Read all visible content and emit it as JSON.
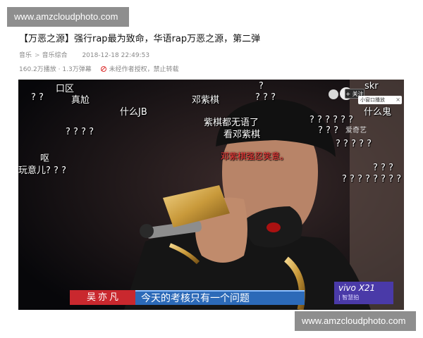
{
  "watermarks": {
    "top": "www.amzcloudphoto.com",
    "bottom": "www.amzcloudphoto.com"
  },
  "article": {
    "title": "【万恶之源】强行rap最为致命，华语rap万恶之源，第二弹",
    "category": "音乐",
    "subcategory": "音乐综合",
    "date": "2018-12-18 22:49:53",
    "plays": "160.2万播放",
    "danmaku_count": "1.3万弹幕",
    "notice": "未经作者授权，禁止转载"
  },
  "video": {
    "follow_label": "+ 关注",
    "mini_window_label": "小窗口播放",
    "close_glyph": "×",
    "channel_tag": "爱奇艺",
    "name_tag": "吴亦凡",
    "subtitle": "今天的考核只有一个问题",
    "sponsor_title": "vivo X21",
    "sponsor_sub": "| 智慧拍"
  },
  "danmaku": [
    {
      "text": "口区"
    },
    {
      "text": "? ?"
    },
    {
      "text": "真尬"
    },
    {
      "text": "邓紫棋"
    },
    {
      "text": "?"
    },
    {
      "text": "? ? ?"
    },
    {
      "text": "skr"
    },
    {
      "text": "什么JB"
    },
    {
      "text": "什么鬼"
    },
    {
      "text": "紫棋都无语了"
    },
    {
      "text": "? ? ? ? ? ?"
    },
    {
      "text": "看邓紫棋"
    },
    {
      "text": "? ? ? ?"
    },
    {
      "text": "? ? ?"
    },
    {
      "text": "呕"
    },
    {
      "text": "? ? ? ? ?"
    },
    {
      "text": "邓紫棋强忍笑意。"
    },
    {
      "text": "玩意儿? ? ?"
    },
    {
      "text": "? ? ?"
    },
    {
      "text": "? ? ? ? ? ? ? ?"
    }
  ],
  "colors": {
    "danmaku_highlight": "#ff3b3b",
    "subtitle_bar": "#2c6ab8",
    "name_tag": "#c9282e"
  }
}
